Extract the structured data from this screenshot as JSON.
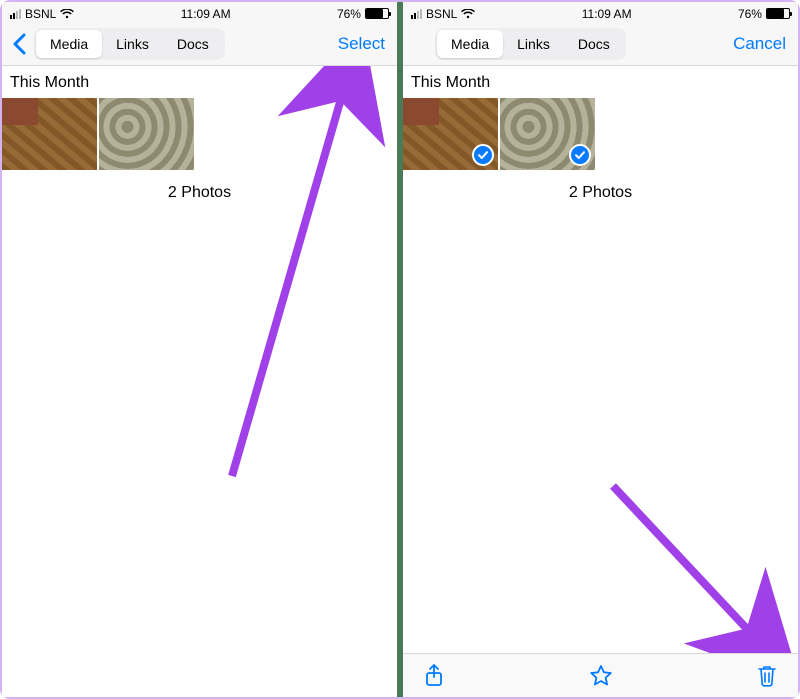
{
  "colors": {
    "accent": "#007aff",
    "arrow": "#a040e8",
    "divider": "#4b7a59",
    "check": "#0a7aff"
  },
  "status": {
    "carrier": "BSNL",
    "time": "11:09 AM",
    "battery_pct": "76%"
  },
  "tabs": {
    "media": "Media",
    "links": "Links",
    "docs": "Docs"
  },
  "left": {
    "action": "Select",
    "section": "This Month",
    "count": "2 Photos"
  },
  "right": {
    "action": "Cancel",
    "section": "This Month",
    "count": "2 Photos"
  },
  "icons": {
    "back": "chevron-left",
    "share": "share",
    "star": "star",
    "trash": "trash",
    "check": "checkmark"
  }
}
